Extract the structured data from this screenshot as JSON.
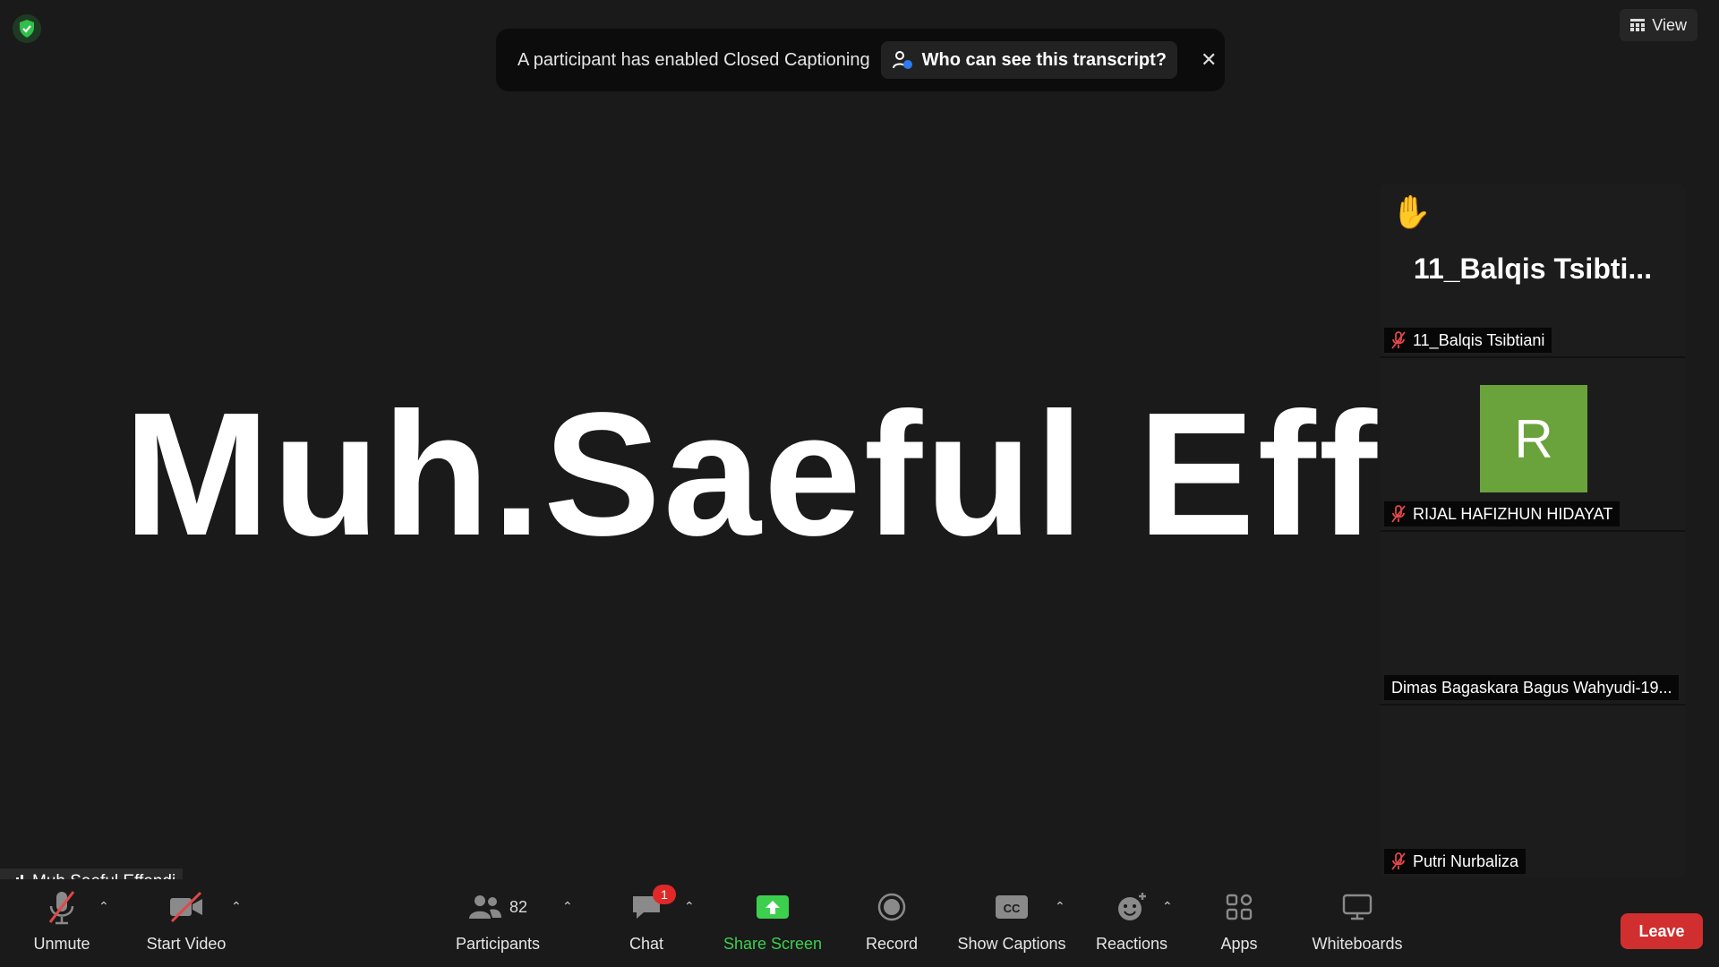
{
  "top": {
    "view_label": "View"
  },
  "banner": {
    "message": "A participant has enabled Closed Captioning",
    "link_label": "Who can see this transcript?",
    "close_glyph": "✕"
  },
  "main": {
    "speaker_name": "Muh.Saeful Effendi"
  },
  "gallery": {
    "tiles": [
      {
        "display_name": "11_Balqis  Tsibti...",
        "name": "11_Balqis Tsibtiani",
        "hand_raised": true,
        "muted": true
      },
      {
        "avatar_letter": "R",
        "avatar_color": "#6aa33b",
        "name": "RIJAL HAFIZHUN HIDAYAT",
        "muted": true
      },
      {
        "name": "Dimas Bagaskara Bagus Wahyudi-19...",
        "muted": false
      },
      {
        "name": "Putri Nurbaliza",
        "muted": true
      }
    ]
  },
  "self": {
    "name": "Muh.Saeful Effendi"
  },
  "toolbar": {
    "unmute": "Unmute",
    "start_video": "Start Video",
    "participants": "Participants",
    "participants_count": "82",
    "chat": "Chat",
    "chat_badge": "1",
    "share_screen": "Share Screen",
    "record": "Record",
    "show_captions": "Show Captions",
    "reactions": "Reactions",
    "apps": "Apps",
    "whiteboards": "Whiteboards",
    "leave": "Leave"
  },
  "colors": {
    "share_green": "#3ccf4e",
    "leave_red": "#d12f2f",
    "badge_red": "#e02828",
    "muted_red": "#e04848"
  },
  "icons": [
    "shield-icon",
    "grid-icon",
    "person-info-icon",
    "close-icon",
    "hand-icon",
    "muted-mic-icon",
    "signal-icon",
    "mic-off-icon",
    "video-off-icon",
    "participants-icon",
    "chat-icon",
    "share-screen-icon",
    "record-icon",
    "captions-icon",
    "reactions-icon",
    "apps-icon",
    "whiteboard-icon"
  ]
}
